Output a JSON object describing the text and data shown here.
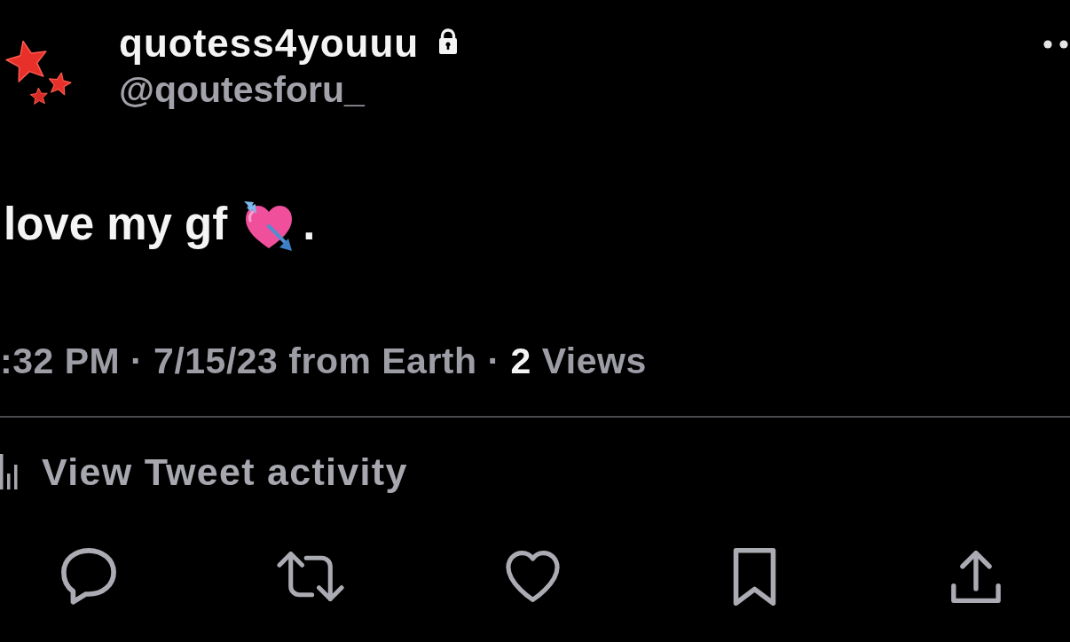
{
  "user": {
    "display_name": "quotess4youuu",
    "protected": true,
    "handle": "@qoutesforu_"
  },
  "tweet": {
    "text": "love my gf",
    "trailing_text": "."
  },
  "meta": {
    "text": ":32 PM · 7/15/23 from Earth · **2** Views"
  },
  "activity_link": {
    "label": "View Tweet activity"
  }
}
